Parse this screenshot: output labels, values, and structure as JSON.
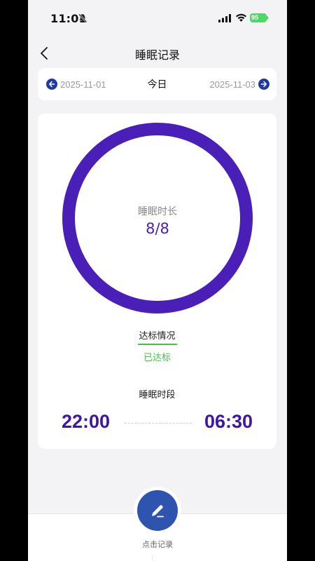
{
  "status_bar": {
    "time": "11:01",
    "battery": "95"
  },
  "nav": {
    "title": "睡眠记录"
  },
  "date_nav": {
    "prev_date": "2025-11-01",
    "current": "今日",
    "next_date": "2025-11-03"
  },
  "summary": {
    "duration_label": "睡眠时长",
    "duration_value": "8/8",
    "progress": 1.0,
    "standard_label": "达标情况",
    "standard_value": "已达标",
    "period_label": "睡眠时段",
    "start_time": "22:00",
    "end_time": "06:30"
  },
  "bottom": {
    "record_label": "点击记录"
  },
  "colors": {
    "ring": "#4a1fb8",
    "accent_green": "#47c14a",
    "time_text": "#3d17a3",
    "nav_circle": "#1f3c9c",
    "record_button": "#2f54b0"
  },
  "icons": {
    "back": "chevron-left-icon",
    "prev": "arrow-left-circle-icon",
    "next": "arrow-right-circle-icon",
    "record": "pencil-icon"
  }
}
